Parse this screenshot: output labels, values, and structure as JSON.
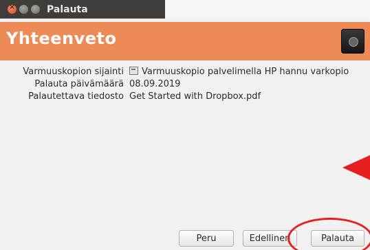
{
  "window": {
    "title": "Palauta"
  },
  "banner": {
    "title": "Yhteenveto",
    "icon": "safe-icon"
  },
  "summary": {
    "rows": [
      {
        "label": "Varmuuskopion sijainti",
        "value": "Varmuuskopio palvelimella HP hannu varkopio",
        "icon": "drive-icon"
      },
      {
        "label": "Palauta päivämäärä",
        "value": "08.09.2019"
      },
      {
        "label": "Palautettava tiedosto",
        "value": "Get Started with Dropbox.pdf"
      }
    ]
  },
  "buttons": {
    "cancel": "Peru",
    "previous": "Edellinen",
    "restore": "Palauta"
  },
  "annotations": {
    "color": "#e51f1f"
  }
}
